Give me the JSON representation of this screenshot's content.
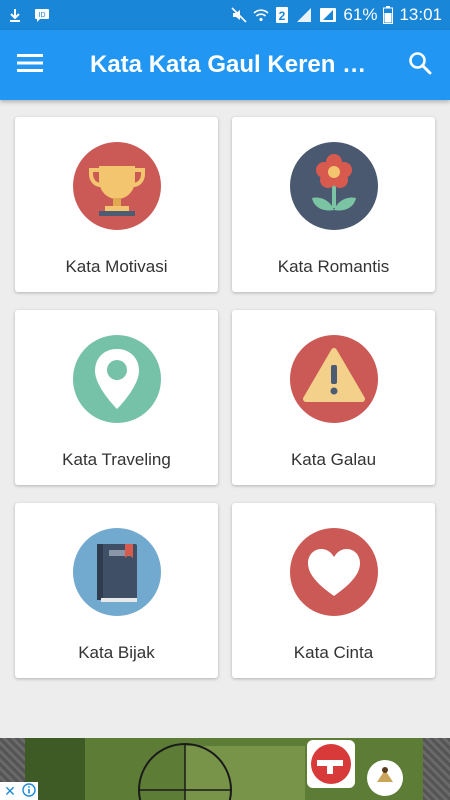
{
  "status_bar": {
    "battery": "61%",
    "time": "13:01",
    "sim": "2"
  },
  "app_bar": {
    "title": "Kata Kata Gaul Keren K..."
  },
  "categories": [
    {
      "label": "Kata Motivasi",
      "icon": "trophy-icon",
      "color": "#cb5a56"
    },
    {
      "label": "Kata Romantis",
      "icon": "flower-icon",
      "color": "#4a5870"
    },
    {
      "label": "Kata Traveling",
      "icon": "location-pin-icon",
      "color": "#76c2a8"
    },
    {
      "label": "Kata Galau",
      "icon": "warning-icon",
      "color": "#cb5a56"
    },
    {
      "label": "Kata Bijak",
      "icon": "book-icon",
      "color": "#71a9cf"
    },
    {
      "label": "Kata Cinta",
      "icon": "heart-icon",
      "color": "#cb5a56"
    }
  ],
  "ad": {
    "close_glyph": "✕"
  }
}
